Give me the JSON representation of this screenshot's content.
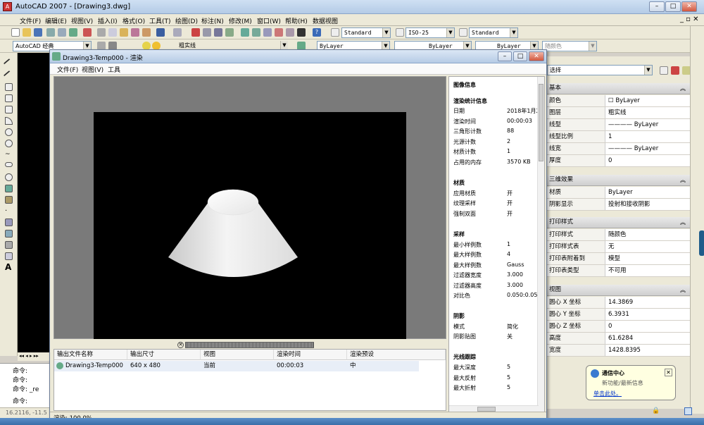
{
  "app": {
    "title": "AutoCAD 2007 - [Drawing3.dwg]"
  },
  "menu": [
    "文件(F)",
    "编辑(E)",
    "视图(V)",
    "插入(I)",
    "格式(O)",
    "工具(T)",
    "绘图(D)",
    "标注(N)",
    "修改(M)",
    "窗口(W)",
    "帮助(H)",
    "数据视图"
  ],
  "toolbar": {
    "text_style": "Standard",
    "dim_style": "ISO-25",
    "table_style": "Standard",
    "workspace": "AutoCAD 经典",
    "layer": "粗实线",
    "color": "ByLayer",
    "linetype": "ByLayer",
    "lineweight": "ByLayer",
    "plotstyle": "随颜色"
  },
  "render_window": {
    "title": "Drawing3-Temp000 - 渲染",
    "menu": [
      "文件(F)",
      "视图(V)",
      "工具"
    ],
    "status": "渲染: 100.0%"
  },
  "info_panel": {
    "title": "图像信息",
    "sections": [
      {
        "title": "渲染统计信息",
        "rows": [
          [
            "日期",
            "2018年1月2"
          ],
          [
            "渲染时间",
            "00:00:03"
          ],
          [
            "三角形计数",
            "88"
          ],
          [
            "光源计数",
            "2"
          ],
          [
            "材质计数",
            "1"
          ],
          [
            "占用的内存",
            "3570 KB"
          ]
        ]
      },
      {
        "title": "材质",
        "rows": [
          [
            "应用材质",
            "开"
          ],
          [
            "纹理采样",
            "开"
          ],
          [
            "强制双面",
            "开"
          ]
        ]
      },
      {
        "title": "采样",
        "rows": [
          [
            "最小样例数",
            "1"
          ],
          [
            "最大样例数",
            "4"
          ],
          [
            "最大样例数",
            "Gauss"
          ],
          [
            "过滤器宽度",
            "3.000"
          ],
          [
            "过滤器高度",
            "3.000"
          ],
          [
            "对比色",
            "0.050:0.050"
          ]
        ]
      },
      {
        "title": "阴影",
        "rows": [
          [
            "模式",
            "简化"
          ],
          [
            "阴影贴图",
            "关"
          ]
        ]
      },
      {
        "title": "光线跟踪",
        "rows": [
          [
            "最大深度",
            "5"
          ],
          [
            "最大反射",
            "5"
          ],
          [
            "最大折射",
            "5"
          ]
        ]
      }
    ]
  },
  "history_table": {
    "headers": [
      "输出文件名称",
      "输出尺寸",
      "视图",
      "渲染时间",
      "渲染预设"
    ],
    "rows": [
      [
        "Drawing3-Temp000",
        "640 x 480",
        "当前",
        "00:00:03",
        "中"
      ]
    ]
  },
  "properties": {
    "selector": "选择",
    "sections": [
      {
        "title": "基本",
        "rows": [
          [
            "颜色",
            "☐ ByLayer"
          ],
          [
            "图层",
            "粗实线"
          ],
          [
            "线型",
            "———— ByLayer"
          ],
          [
            "线型比例",
            "1"
          ],
          [
            "线宽",
            "———— ByLayer"
          ],
          [
            "厚度",
            "0"
          ]
        ]
      },
      {
        "title": "三维效果",
        "rows": [
          [
            "材质",
            "ByLayer"
          ],
          [
            "阴影显示",
            "投射和接收阴影"
          ]
        ]
      },
      {
        "title": "打印样式",
        "rows": [
          [
            "打印样式",
            "随颜色"
          ],
          [
            "打印样式表",
            "无"
          ],
          [
            "打印表附着到",
            "模型"
          ],
          [
            "打印表类型",
            "不可用"
          ]
        ]
      },
      {
        "title": "视图",
        "rows": [
          [
            "圆心 X 坐标",
            "14.3869"
          ],
          [
            "圆心 Y 坐标",
            "6.3931"
          ],
          [
            "圆心 Z 坐标",
            "0"
          ],
          [
            "高度",
            "61.6284"
          ],
          [
            "宽度",
            "1428.8395"
          ]
        ]
      }
    ]
  },
  "command": {
    "lines": [
      "命令:",
      "命令:",
      "命令: _re",
      "命令:"
    ],
    "coords": "16.2116, -11.5"
  },
  "notification": {
    "title": "通信中心",
    "body": "新功能/最新信息",
    "link": "单击此处。"
  },
  "colors": {
    "accent": "#316ac5",
    "canvas": "#000000",
    "cone": "#e8e8e8"
  }
}
